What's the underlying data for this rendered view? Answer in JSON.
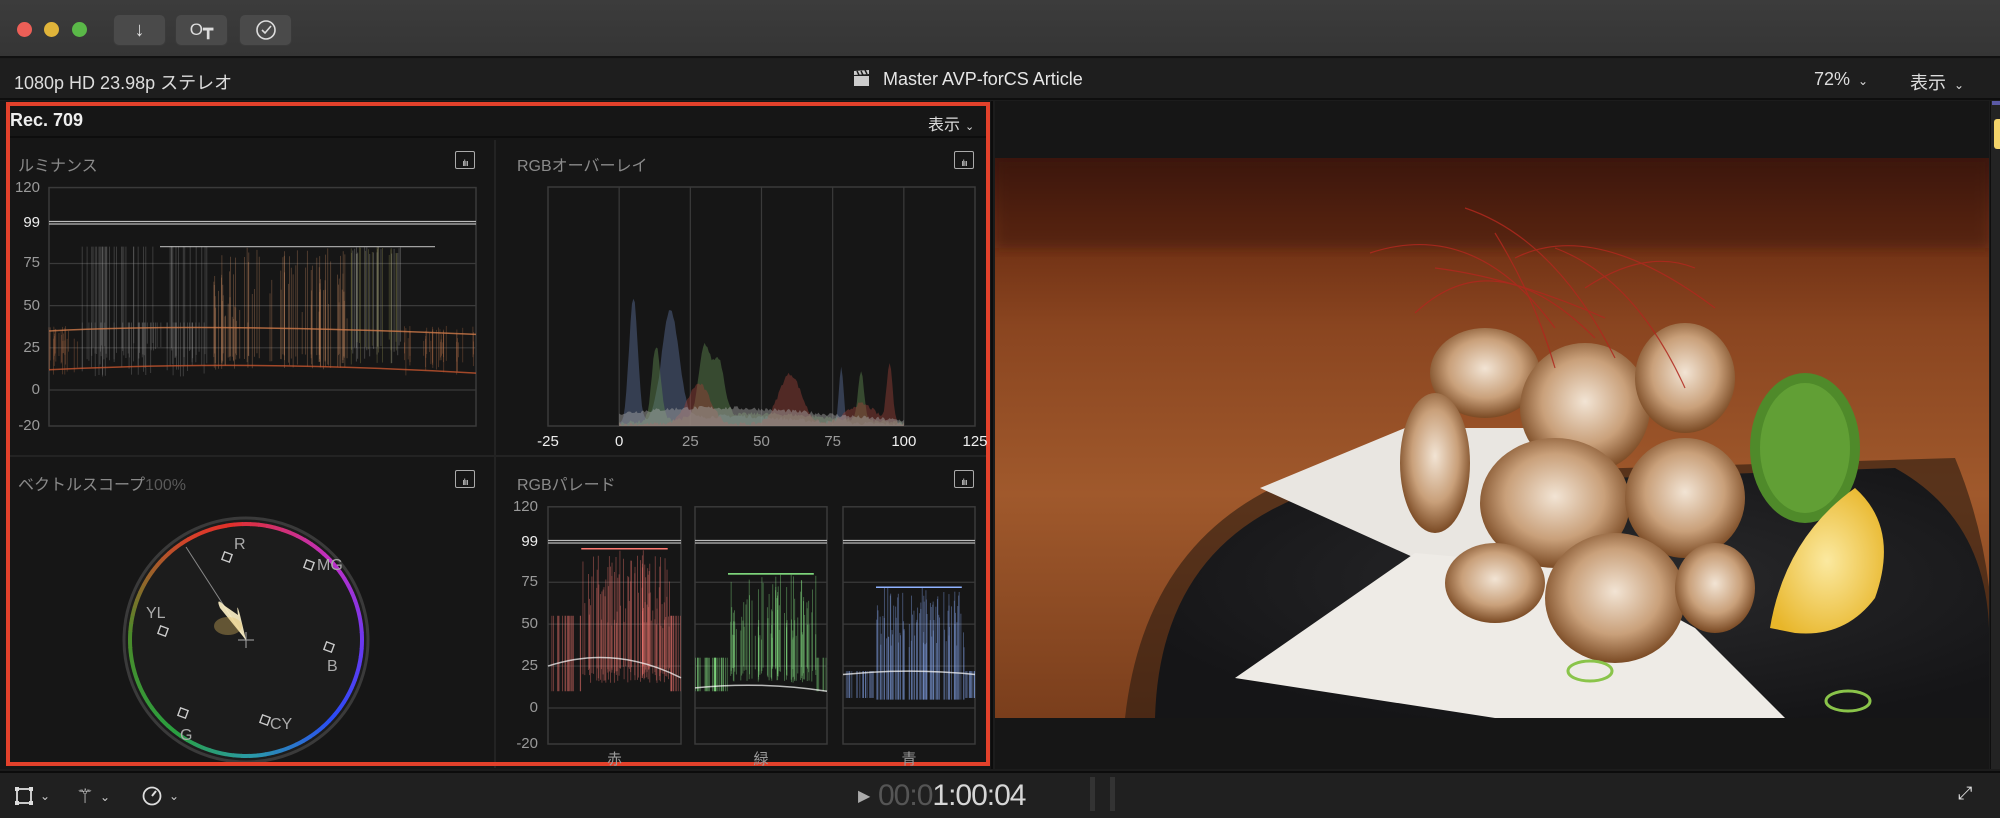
{
  "window": {
    "toolbar": {
      "import_icon": "arrow-down-icon",
      "keyword_icon": "key-icon",
      "background_tasks_icon": "checkmark-circle-icon"
    }
  },
  "viewer_header": {
    "format": "1080p HD 23.98p ステレオ",
    "project_title": "Master AVP-forCS Article",
    "zoom": "72%",
    "view_menu": "表示"
  },
  "scopes": {
    "standard": "Rec. 709",
    "view_menu": "表示",
    "luma": {
      "title": "ルミナンス",
      "ticks": [
        "120",
        "99",
        "75",
        "50",
        "25",
        "0",
        "-20"
      ]
    },
    "overlay": {
      "title": "RGBオーバーレイ",
      "ticks": [
        "-25",
        "0",
        "25",
        "50",
        "75",
        "100",
        "125"
      ]
    },
    "vectorscope": {
      "title": "ベクトルスコープ",
      "scale": "100%",
      "targets": [
        "R",
        "MG",
        "YL",
        "B",
        "G",
        "CY"
      ]
    },
    "parade": {
      "title": "RGBパレード",
      "ticks": [
        "120",
        "99",
        "75",
        "50",
        "25",
        "0",
        "-20"
      ],
      "channels": [
        "赤",
        "緑",
        "青"
      ]
    },
    "colors": {
      "highlight": "#e3412b",
      "red": "#ff7b74",
      "green": "#8cf08a",
      "blue": "#8fb2ff"
    }
  },
  "transport": {
    "timecode_dim": "00:0",
    "timecode_bright": "1:00:04"
  }
}
